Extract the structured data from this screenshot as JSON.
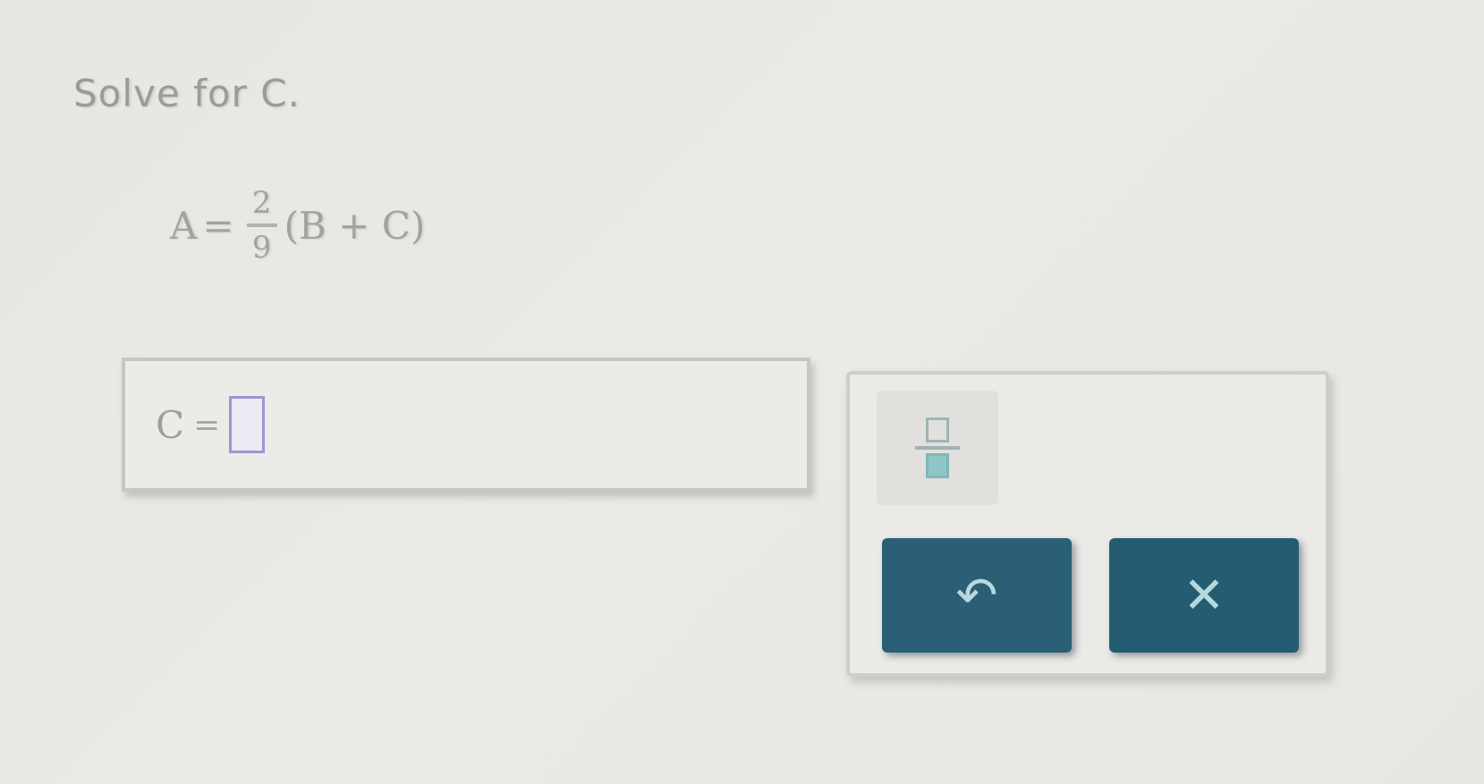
{
  "prompt": "Solve for C.",
  "equation": {
    "lhs": "A",
    "equals": "=",
    "fraction": {
      "numerator": "2",
      "denominator": "9"
    },
    "rhs": "(B + C)"
  },
  "answer": {
    "variable": "C",
    "equals": "="
  },
  "tools": {
    "fraction_icon": "fraction-icon",
    "undo_symbol": "↶",
    "clear_symbol": "✕"
  },
  "colors": {
    "button": "#2b5f75",
    "slot_border": "#9c95d6"
  }
}
